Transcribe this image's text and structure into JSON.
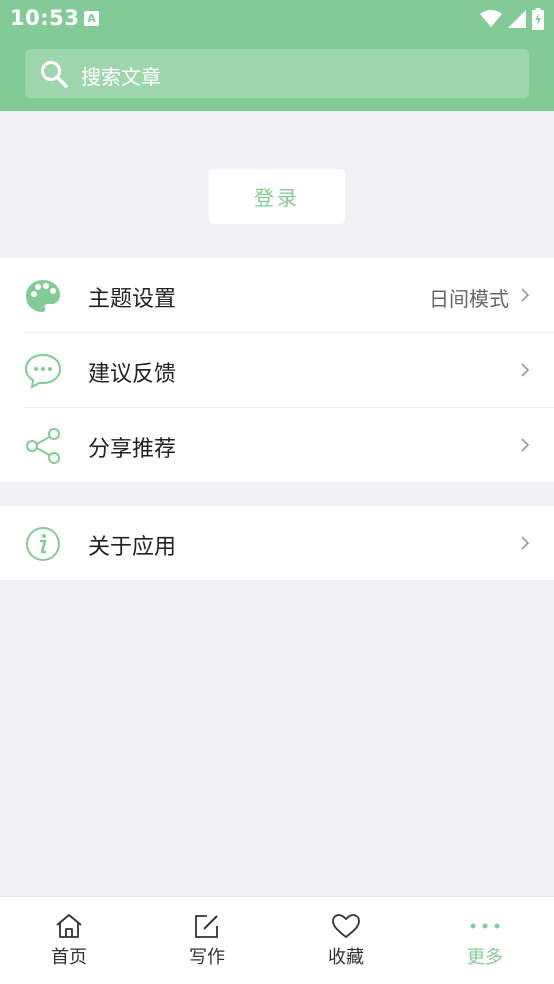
{
  "status_bar": {
    "time": "10:53",
    "notification_letter": "A"
  },
  "search": {
    "placeholder": "搜索文章"
  },
  "login": {
    "label": "登录"
  },
  "settings": {
    "theme": {
      "label": "主题设置",
      "value": "日间模式"
    },
    "feedback": {
      "label": "建议反馈"
    },
    "share": {
      "label": "分享推荐"
    },
    "about": {
      "label": "关于应用"
    }
  },
  "tabbar": {
    "tabs": [
      {
        "label": "首页",
        "icon": "home-icon",
        "active": false
      },
      {
        "label": "写作",
        "icon": "edit-icon",
        "active": false
      },
      {
        "label": "收藏",
        "icon": "heart-icon",
        "active": false
      },
      {
        "label": "更多",
        "icon": "more-dots-icon",
        "active": true
      }
    ]
  },
  "colors": {
    "accent": "#82cb96",
    "background": "#f3f3f5",
    "text": "#222222"
  }
}
